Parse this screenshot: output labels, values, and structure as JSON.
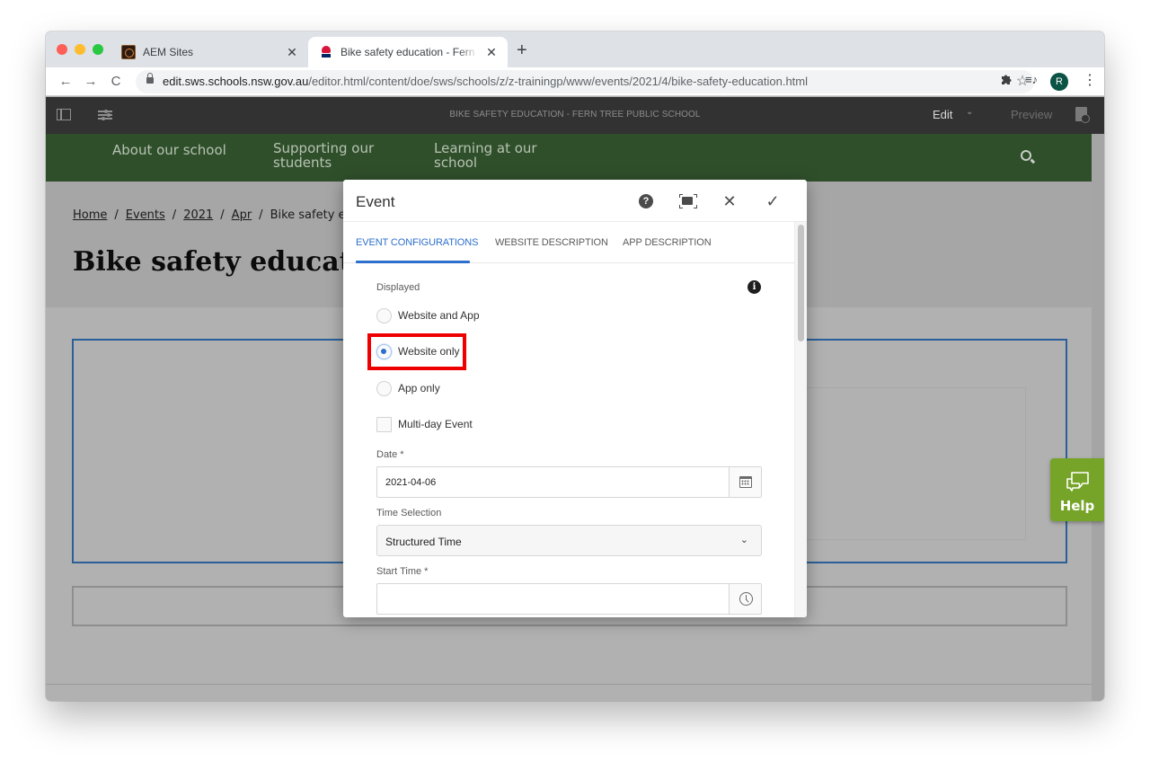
{
  "browser": {
    "tabs": [
      {
        "title": "AEM Sites",
        "icon": "aem-favicon",
        "active": false
      },
      {
        "title": "Bike safety education - Fern Tree Public School",
        "icon": "nsw-waratah-favicon",
        "active": true
      }
    ],
    "new_tab_label": "+",
    "tab_close_label": "✕",
    "url_host": "edit.sws.schools.nsw.gov.au",
    "url_path": "/editor.html/content/doe/sws/schools/z/z-trainingp/www/events/2021/4/bike-safety-education.html",
    "nav": {
      "back": "←",
      "forward": "→",
      "reload": "C"
    },
    "bookmark_star": "☆",
    "extensions_icon": "puzzle-piece",
    "media_icon": "≡♪",
    "profile_initial": "R",
    "menu_icon": "⋮"
  },
  "aem_bar": {
    "page_title": "BIKE SAFETY EDUCATION - FERN TREE PUBLIC SCHOOL",
    "mode_label": "Edit",
    "mode_caret": "⌄",
    "preview_label": "Preview"
  },
  "site": {
    "nav_items": [
      {
        "label": "About our school"
      },
      {
        "label": "Supporting our students"
      },
      {
        "label": "Learning at our school"
      }
    ],
    "breadcrumb": [
      {
        "label": "Home",
        "link": true
      },
      {
        "label": "Events",
        "link": true
      },
      {
        "label": "2021",
        "link": true
      },
      {
        "label": "Apr",
        "link": true
      },
      {
        "label": "Bike safety education",
        "link": false
      }
    ],
    "breadcrumb_separator": "/",
    "page_title": "Bike safety education",
    "ghost_text": "e",
    "help_label": "Help"
  },
  "dialog": {
    "title": "Event",
    "header_buttons": {
      "help": "?",
      "close": "✕",
      "done": "✓"
    },
    "tabs": [
      {
        "label": "EVENT CONFIGURATIONS",
        "active": true
      },
      {
        "label": "WEBSITE DESCRIPTION",
        "active": false
      },
      {
        "label": "APP DESCRIPTION",
        "active": false
      }
    ],
    "displayed": {
      "label": "Displayed",
      "info_icon": "i",
      "options": [
        {
          "label": "Website and App",
          "checked": false
        },
        {
          "label": "Website only",
          "checked": true
        },
        {
          "label": "App only",
          "checked": false
        }
      ]
    },
    "multi_day": {
      "label": "Multi-day Event",
      "checked": false
    },
    "date": {
      "label": "Date *",
      "value": "2021-04-06"
    },
    "time_selection": {
      "label": "Time Selection",
      "value": "Structured Time",
      "caret": "⌄"
    },
    "start_time": {
      "label": "Start Time *",
      "value": ""
    }
  },
  "colors": {
    "site_nav_green": "#2f4f2a",
    "accent_blue": "#2d6fcc",
    "help_green": "#76a428",
    "highlight_red": "#ee0000",
    "aem_bar": "#323232"
  }
}
